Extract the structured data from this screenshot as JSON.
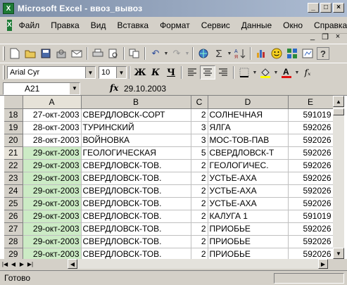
{
  "window": {
    "app_title": "Microsoft Excel - ввоз_вывоз",
    "icon_letter": "X",
    "buttons": {
      "minimize": "_",
      "maximize": "□",
      "close": "×"
    }
  },
  "menubar": {
    "items": [
      "Файл",
      "Правка",
      "Вид",
      "Вставка",
      "Формат",
      "Сервис",
      "Данные",
      "Окно",
      "Справка"
    ],
    "doc_buttons": {
      "minimize": "_",
      "restore": "❐",
      "close": "×"
    }
  },
  "toolbar": {
    "font_name": "Arial Cyr",
    "font_size": "10",
    "bold_label": "Ж",
    "italic_label": "К",
    "underline_label": "Ч",
    "undo_icon": "↶",
    "redo_icon": "↷",
    "sum_icon": "Σ",
    "fx_icon": "fₓ",
    "help_icon": "?"
  },
  "formula_bar": {
    "cell_ref": "A21",
    "fx_label": "fx",
    "value": "29.10.2003"
  },
  "grid": {
    "columns": [
      "A",
      "B",
      "C",
      "D",
      "E"
    ],
    "active_column": "A",
    "active_row": "21",
    "rows": [
      {
        "num": "18",
        "a": "27-окт-2003",
        "b": "СВЕРДЛОВСК-СОРТ",
        "c": "2",
        "d": "СОЛНЕЧНАЯ",
        "e": "591019"
      },
      {
        "num": "19",
        "a": "28-окт-2003",
        "b": "ТУРИНСКИЙ",
        "c": "3",
        "d": "ЯЛГА",
        "e": "592026"
      },
      {
        "num": "20",
        "a": "28-окт-2003",
        "b": "ВОЙНОВКА",
        "c": "3",
        "d": "МОС-ТОВ-ПАВ",
        "e": "592026"
      },
      {
        "num": "21",
        "a": "29-окт-2003",
        "b": "ГЕОЛОГИЧЕСКАЯ",
        "c": "5",
        "d": "СВЕРДЛОВСК-Т",
        "e": "592026"
      },
      {
        "num": "22",
        "a": "29-окт-2003",
        "b": "СВЕРДЛОВСК-ТОВ.",
        "c": "2",
        "d": "ГЕОЛОГИЧЕС.",
        "e": "592026"
      },
      {
        "num": "23",
        "a": "29-окт-2003",
        "b": "СВЕРДЛОВСК-ТОВ.",
        "c": "2",
        "d": "УСТЬЕ-АХА",
        "e": "592026"
      },
      {
        "num": "24",
        "a": "29-окт-2003",
        "b": "СВЕРДЛОВСК-ТОВ.",
        "c": "2",
        "d": "УСТЬЕ-АХА",
        "e": "592026"
      },
      {
        "num": "25",
        "a": "29-окт-2003",
        "b": "СВЕРДЛОВСК-ТОВ.",
        "c": "2",
        "d": "УСТЬЕ-АХА",
        "e": "592026"
      },
      {
        "num": "26",
        "a": "29-окт-2003",
        "b": "СВЕРДЛОВСК-ТОВ.",
        "c": "2",
        "d": "КАЛУГА 1",
        "e": "591019"
      },
      {
        "num": "27",
        "a": "29-окт-2003",
        "b": "СВЕРДЛОВСК-ТОВ.",
        "c": "2",
        "d": "ПРИОБЬЕ",
        "e": "592026"
      },
      {
        "num": "28",
        "a": "29-окт-2003",
        "b": "СВЕРДЛОВСК-ТОВ.",
        "c": "2",
        "d": "ПРИОБЬЕ",
        "e": "592026"
      },
      {
        "num": "29",
        "a": "29-окт-2003",
        "b": "СВЕРДЛОВСК-ТОВ.",
        "c": "2",
        "d": "ПРИОБЬЕ",
        "e": "592026"
      }
    ]
  },
  "status": {
    "text": "Готово"
  },
  "colors": {
    "selection_fill": "#ccebc5",
    "titlebar_start": "#7d8ea8",
    "titlebar_end": "#aebdd3"
  }
}
